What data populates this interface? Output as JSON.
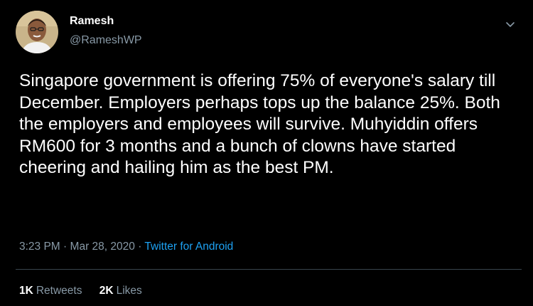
{
  "user": {
    "display_name": "Ramesh",
    "handle": "@RameshWP"
  },
  "tweet": {
    "text": "Singapore government is offering 75% of everyone's salary till December. Employers perhaps tops up the balance 25%. Both the employers and employees will survive. Muhyiddin offers RM600 for 3 months and a bunch of clowns have started cheering and hailing him as the best PM.",
    "time": "3:23 PM",
    "separator": "·",
    "date": "Mar 28, 2020",
    "source": "Twitter for Android"
  },
  "stats": {
    "retweets_count": "1K",
    "retweets_label": "Retweets",
    "likes_count": "2K",
    "likes_label": "Likes"
  },
  "icons": {
    "caret": "chevron-down-icon",
    "avatar": "avatar"
  },
  "colors": {
    "background": "#000000",
    "primary_text": "#ffffff",
    "secondary_text": "#8899a6",
    "link": "#1da1f2",
    "divider": "#38444d"
  }
}
